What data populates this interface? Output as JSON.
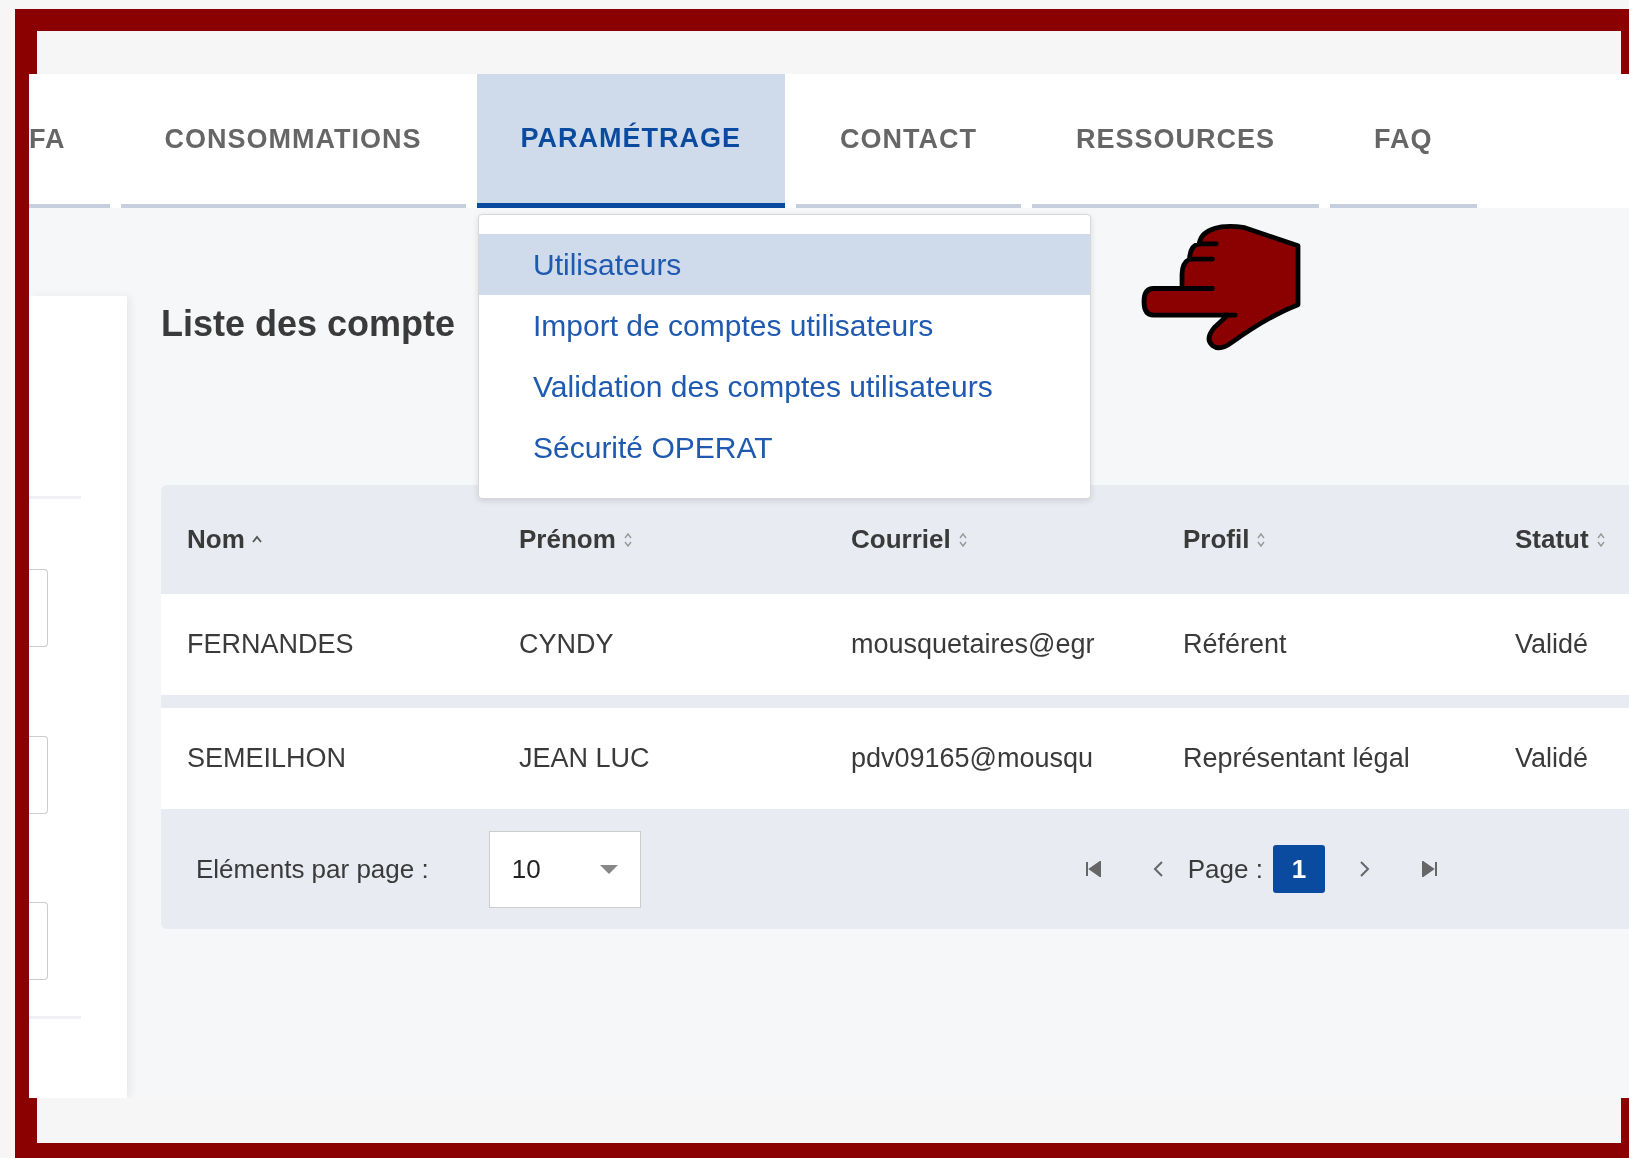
{
  "nav_tabs": [
    {
      "label": "FA",
      "selected": false
    },
    {
      "label": "CONSOMMATIONS",
      "selected": false
    },
    {
      "label": "PARAMÉTRAGE",
      "selected": true
    },
    {
      "label": "CONTACT",
      "selected": false
    },
    {
      "label": "RESSOURCES",
      "selected": false
    },
    {
      "label": "FAQ",
      "selected": false
    }
  ],
  "menu": {
    "items": [
      {
        "label": "Utilisateurs",
        "selected": true
      },
      {
        "label": "Import de comptes utilisateurs",
        "selected": false
      },
      {
        "label": "Validation des comptes utilisateurs",
        "selected": false
      },
      {
        "label": "Sécurité OPERAT",
        "selected": false
      }
    ]
  },
  "title": "Liste des compte",
  "table": {
    "columns": [
      {
        "label": "Nom",
        "sorted_ascending": true
      },
      {
        "label": "Prénom",
        "sorted_ascending": false
      },
      {
        "label": "Courriel",
        "sorted_ascending": false
      },
      {
        "label": "Profil",
        "sorted_ascending": false
      },
      {
        "label": "Statut",
        "sorted_ascending": false
      }
    ],
    "rows": [
      [
        "FERNANDES",
        "CYNDY",
        "mousquetaires@egr",
        "Référent",
        "Validé"
      ],
      [
        "SEMEILHON",
        "JEAN LUC",
        "pdv09165@mousqu",
        "Représentant légal",
        "Validé"
      ]
    ]
  },
  "pagination": {
    "per_page_label": "Eléments par page :",
    "per_page_value": "10",
    "page_label": "Page :",
    "current_page": "1"
  }
}
